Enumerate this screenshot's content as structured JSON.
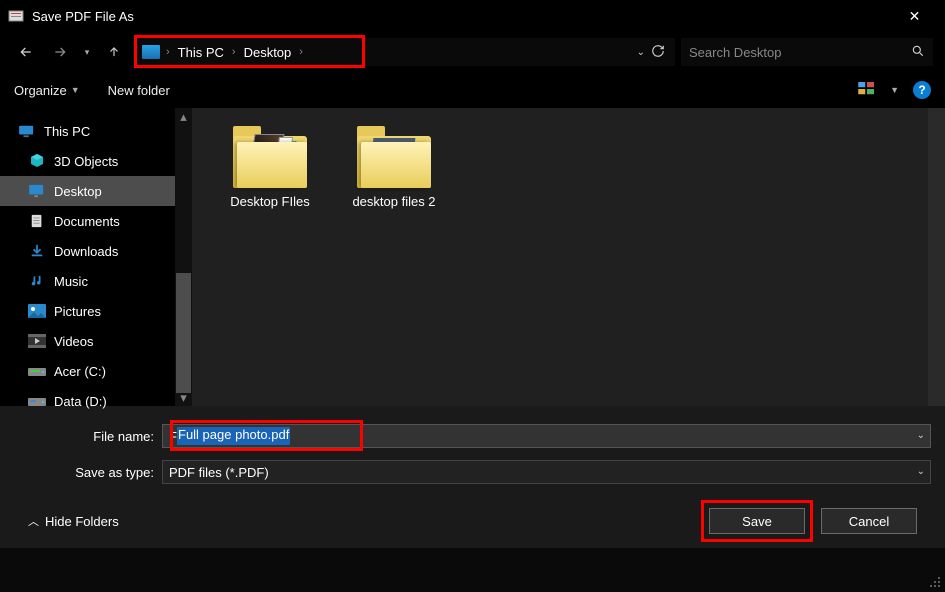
{
  "window": {
    "title": "Save PDF File As",
    "close_glyph": "✕"
  },
  "nav": {
    "breadcrumb": [
      "This PC",
      "Desktop"
    ],
    "search_placeholder": "Search Desktop"
  },
  "toolbar": {
    "organize": "Organize",
    "new_folder": "New folder"
  },
  "sidebar": {
    "items": [
      {
        "label": "This PC",
        "icon": "pc"
      },
      {
        "label": "3D Objects",
        "icon": "3d"
      },
      {
        "label": "Desktop",
        "icon": "desktop",
        "selected": true
      },
      {
        "label": "Documents",
        "icon": "doc"
      },
      {
        "label": "Downloads",
        "icon": "dl"
      },
      {
        "label": "Music",
        "icon": "music"
      },
      {
        "label": "Pictures",
        "icon": "pic"
      },
      {
        "label": "Videos",
        "icon": "vid"
      },
      {
        "label": "Acer (C:)",
        "icon": "drive"
      },
      {
        "label": "Data (D:)",
        "icon": "drive"
      }
    ]
  },
  "content": {
    "folders": [
      {
        "label": "Desktop FIles"
      },
      {
        "label": "desktop files 2"
      }
    ]
  },
  "form": {
    "filename_label": "File name:",
    "filename_value": "Full page photo.pdf",
    "type_label": "Save as type:",
    "type_value": "PDF files (*.PDF)"
  },
  "footer": {
    "hide_folders": "Hide Folders",
    "save": "Save",
    "cancel": "Cancel"
  }
}
